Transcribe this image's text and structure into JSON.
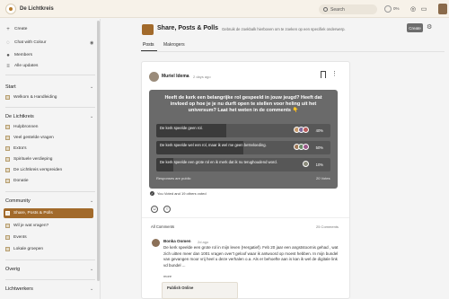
{
  "app": {
    "name": "De Lichtkreis"
  },
  "topbar": {
    "search_placeholder": "Search",
    "progress_label": "0%"
  },
  "sidebar": {
    "create": "Create",
    "chat": "Chat with Colour",
    "members": "Members",
    "updates": "Alle updates",
    "start_header": "Start",
    "start_items": [
      "Welkom & Handleiding"
    ],
    "lichtkreis_header": "De Lichtkreis",
    "lichtkreis_items": [
      "Hulpbronnen",
      "Veel gestelde vragen",
      "Extra's",
      "Spirituele verdieping",
      "De Lichtkreis verspreiden",
      "Donatie"
    ],
    "community_header": "Community",
    "community_items": [
      "Share, Posts & Polls",
      "Wil je wat vragen?",
      "Events",
      "Lokale groepen"
    ],
    "overig_header": "Overig",
    "lichtwerkers_header": "Lichtwerkers"
  },
  "header": {
    "title": "Share, Posts & Polls",
    "subtitle": "Gebruik de zoekbalk hierboven om te zoeken op een specifiek onderwerp.",
    "create_button": "Create",
    "tabs": [
      "Posts",
      "Makrogers"
    ]
  },
  "post": {
    "author": "Muriel Idema",
    "time": "2 days ago",
    "poll": {
      "question": "Heeft de kerk een belangrijke rol gespeeld in jouw jeugd? Heeft dat invloed op hoe je je nu durft open te stellen voor heling uit het universum? Laat het weten in de comments 👇",
      "options": [
        {
          "label": "De kerk speelde geen rol.",
          "percent": 40,
          "pct_text": "40%"
        },
        {
          "label": "De kerk speelde wel een rol, maar ik wel me geen beïnvloeding.",
          "percent": 50,
          "pct_text": "50%"
        },
        {
          "label": "De kerk speelde een grote rol en ik merk dat ik nu terughoudend word.",
          "percent": 10,
          "pct_text": "10%"
        }
      ],
      "footer": "Responses are public",
      "votes": "20 Votes"
    },
    "voted_text": "You Voted and 19 others voted",
    "all_comments": "All Comments",
    "comment_count": "25 Comments"
  },
  "comment": {
    "author": "Bonka Oomen",
    "time": "2d ago",
    "text": "De kerk speelde een grote rol in mijn leven (Hergatief). Feb 20 jaar een angststoornis gehad , wat zich uitten meer dan 1001 vragen over't geloof waar ik antwoord op moest hebben. In mijn bundel van gevangen moor vrij heel u deze verhalen o.a. Als er behoefte aan is kan ik wel de digitale link vd bundel ...",
    "more": "more",
    "embed_title": "Publish Online"
  },
  "colors": {
    "accent": "#a26a2b",
    "poll_bg": "#6a6a6a"
  }
}
